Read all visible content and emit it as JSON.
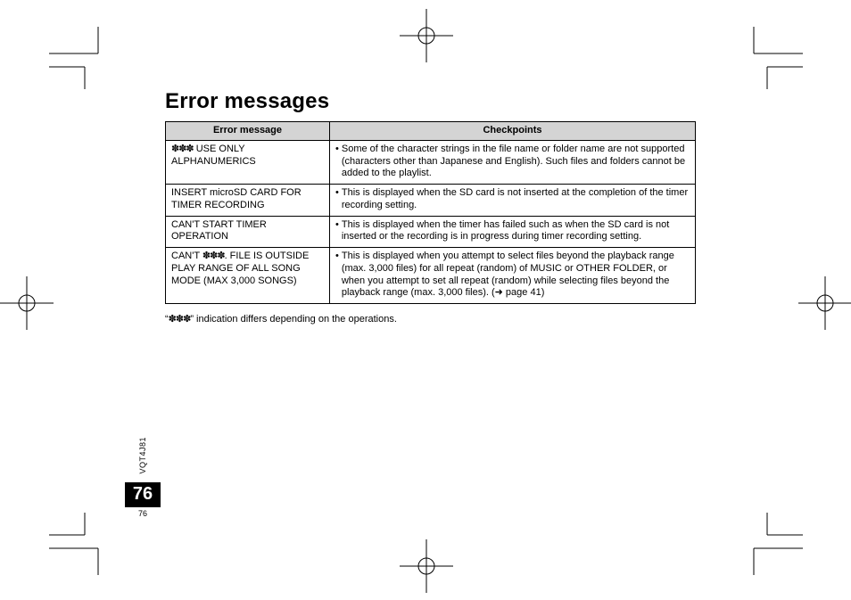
{
  "title": "Error messages",
  "headers": {
    "col1": "Error message",
    "col2": "Checkpoints"
  },
  "asterisks": "✽✽✽",
  "rows": [
    {
      "msg_prefix_ast": true,
      "msg": " USE ONLY ALPHANUMERICS",
      "check": "Some of the character strings in the file name or folder name are not supported (characters other than Japanese and English). Such files and folders cannot be added to the playlist."
    },
    {
      "msg": "INSERT microSD CARD FOR TIMER RECORDING",
      "check": "This is displayed when the SD card is not inserted at the completion of the timer recording setting."
    },
    {
      "msg": "CAN'T START TIMER OPERATION",
      "check": "This is displayed when the timer has failed such as when the SD card is not inserted or the recording is in progress during timer recording setting."
    },
    {
      "msg_prefix": "CAN'T ",
      "msg_prefix_ast_mid": true,
      "msg_suffix": ". FILE IS OUTSIDE PLAY RANGE OF ALL SONG MODE (MAX 3,000 SONGS)",
      "check": "This is displayed when you attempt to select files beyond the playback range (max. 3,000 files) for all repeat (random) of MUSIC or OTHER FOLDER, or when you attempt to set all repeat (random) while selecting files beyond the playback range (max. 3,000 files). (➜ page 41)"
    }
  ],
  "footnote_pre": "“",
  "footnote_post": "” indication differs depending on the operations.",
  "doc_code": "VQT4J81",
  "page_number": "76",
  "page_tiny": "76"
}
